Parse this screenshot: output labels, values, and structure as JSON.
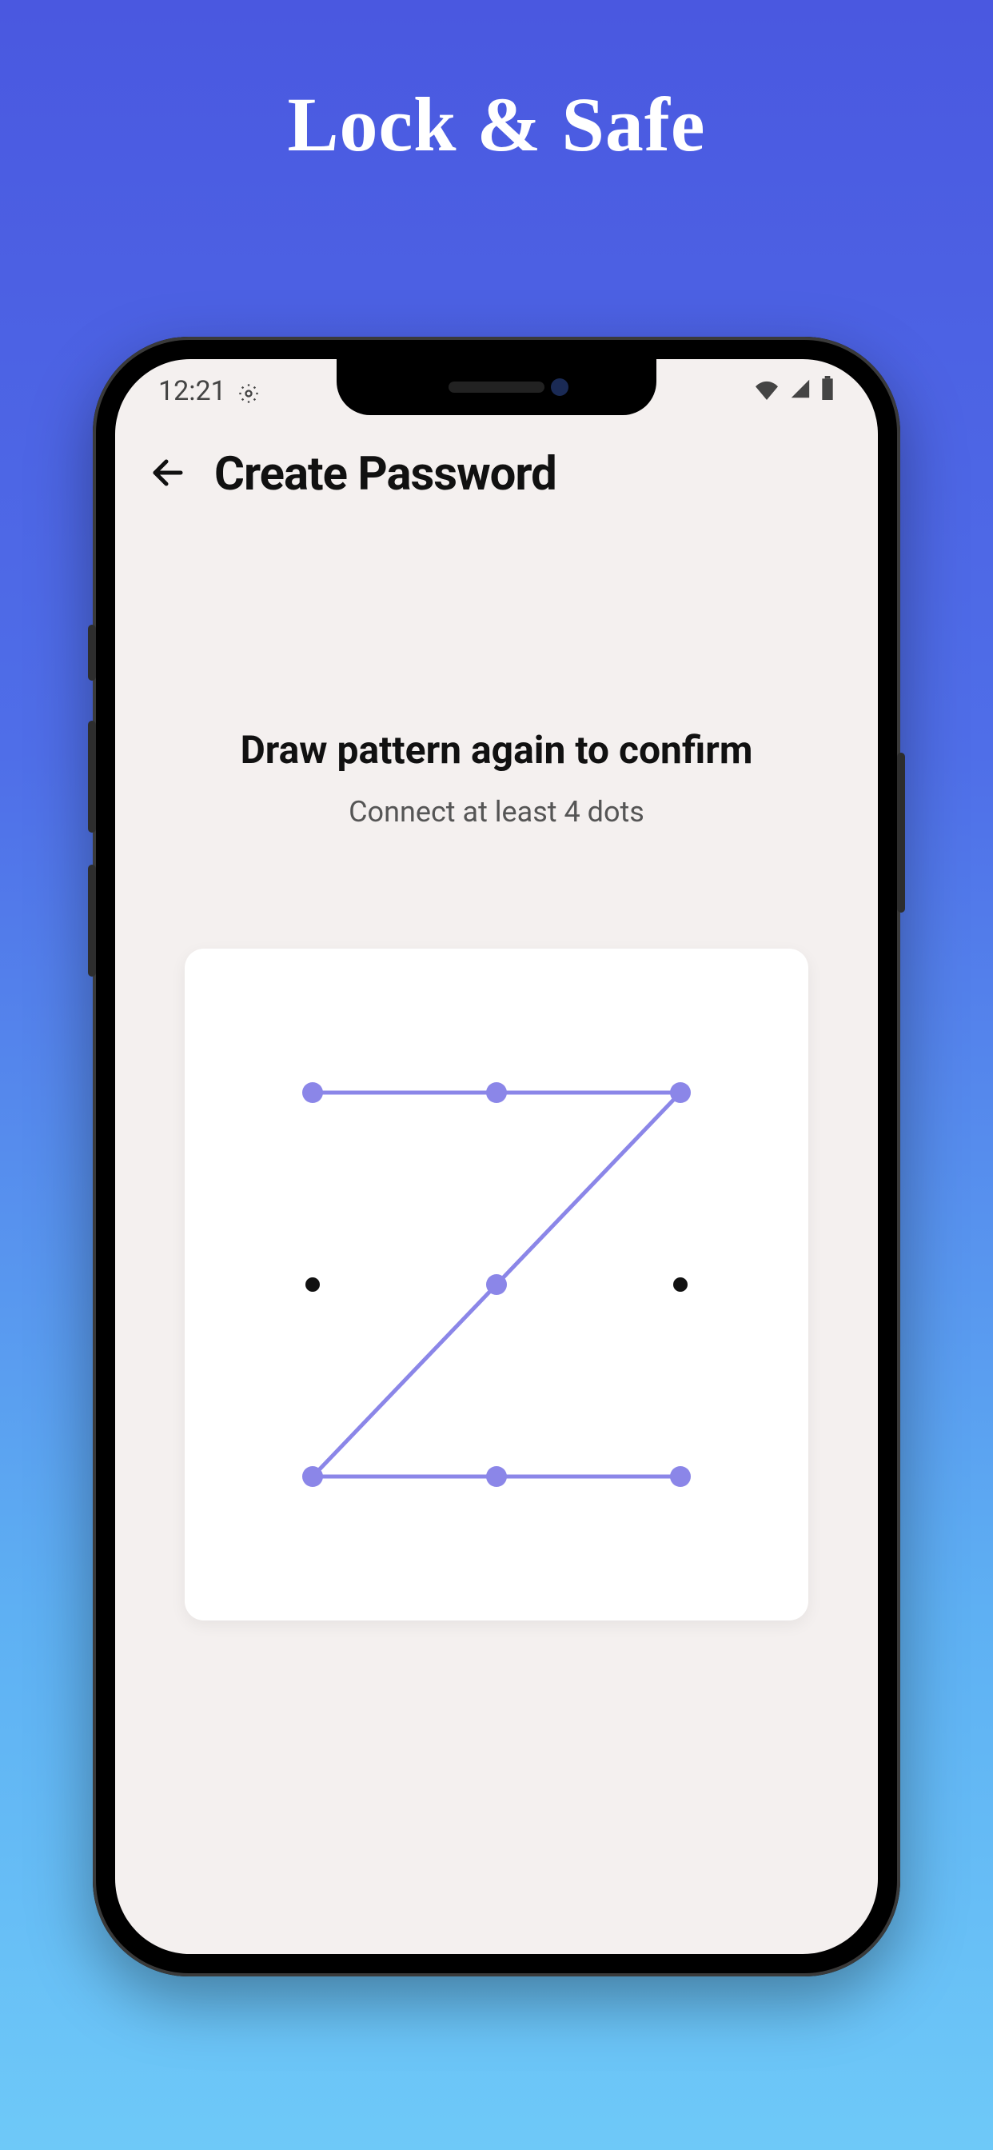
{
  "promo": {
    "title": "Lock & Safe"
  },
  "status": {
    "time": "12:21"
  },
  "appbar": {
    "title": "Create Password"
  },
  "content": {
    "heading": "Draw pattern again to confirm",
    "subheading": "Connect at least 4 dots"
  },
  "pattern": {
    "grid_size": 3,
    "active_color": "#8b86e8",
    "inactive_color": "#111111",
    "dots": [
      {
        "id": 1,
        "row": 0,
        "col": 0,
        "active": true
      },
      {
        "id": 2,
        "row": 0,
        "col": 1,
        "active": true
      },
      {
        "id": 3,
        "row": 0,
        "col": 2,
        "active": true
      },
      {
        "id": 4,
        "row": 1,
        "col": 0,
        "active": false
      },
      {
        "id": 5,
        "row": 1,
        "col": 1,
        "active": true
      },
      {
        "id": 6,
        "row": 1,
        "col": 2,
        "active": false
      },
      {
        "id": 7,
        "row": 2,
        "col": 0,
        "active": true
      },
      {
        "id": 8,
        "row": 2,
        "col": 1,
        "active": true
      },
      {
        "id": 9,
        "row": 2,
        "col": 2,
        "active": true
      }
    ],
    "path": [
      1,
      2,
      3,
      5,
      7,
      8,
      9
    ]
  }
}
